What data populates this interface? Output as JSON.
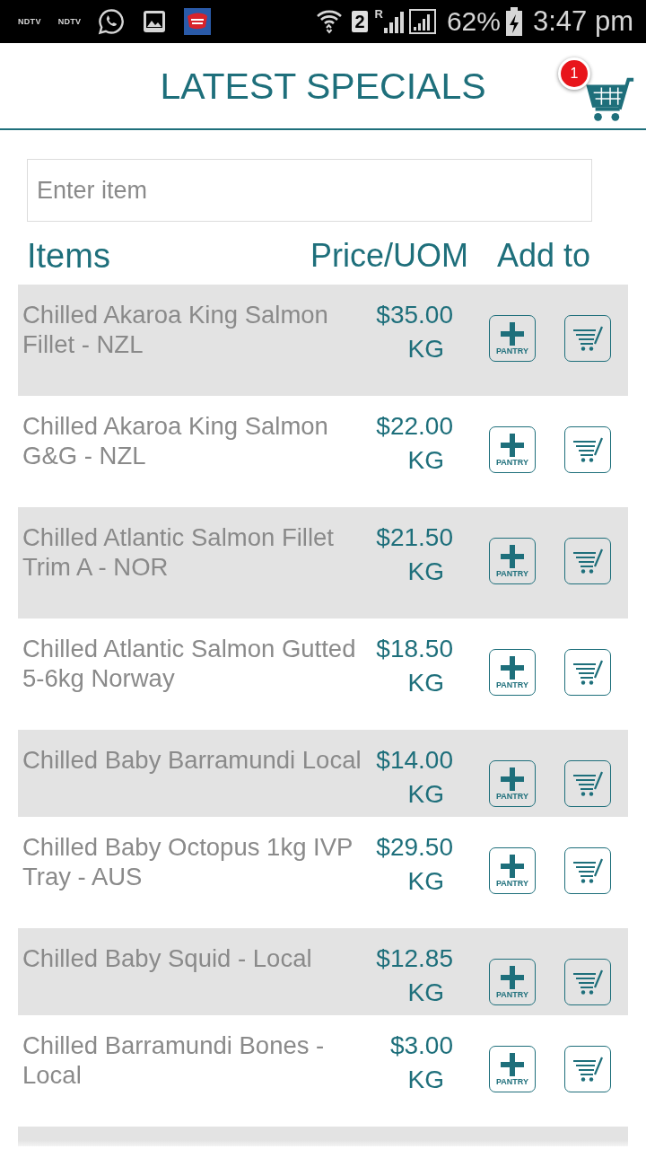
{
  "status_bar": {
    "notification_labels": [
      "NDTV",
      "NDTV"
    ],
    "sim": "2",
    "roaming": "R",
    "battery": "62%",
    "time": "3:47 pm"
  },
  "header": {
    "title": "LATEST SPECIALS",
    "cart_count": "1"
  },
  "search": {
    "placeholder": "Enter item"
  },
  "columns": [
    "Items",
    "Price/UOM",
    "Add to"
  ],
  "rows": [
    {
      "name": "Chilled Akaroa King Salmon Fillet - NZL",
      "price": "$35.00",
      "uom": "KG",
      "pantry_label": "PANTRY"
    },
    {
      "name": "Chilled Akaroa King Salmon G&G - NZL",
      "price": "$22.00",
      "uom": "KG",
      "pantry_label": "PANTRY"
    },
    {
      "name": "Chilled Atlantic Salmon Fillet Trim A - NOR",
      "price": "$21.50",
      "uom": "KG",
      "pantry_label": "PANTRY"
    },
    {
      "name": "Chilled Atlantic Salmon Gutted 5-6kg Norway",
      "price": "$18.50",
      "uom": "KG",
      "pantry_label": "PANTRY"
    },
    {
      "name": "Chilled Baby Barramundi Local",
      "price": "$14.00",
      "uom": "KG",
      "pantry_label": "PANTRY"
    },
    {
      "name": "Chilled Baby Octopus 1kg IVP Tray - AUS",
      "price": "$29.50",
      "uom": "KG",
      "pantry_label": "PANTRY"
    },
    {
      "name": "Chilled Baby Squid - Local",
      "price": "$12.85",
      "uom": "KG",
      "pantry_label": "PANTRY"
    },
    {
      "name": "Chilled Barramundi Bones - Local",
      "price": "$3.00",
      "uom": "KG",
      "pantry_label": "PANTRY"
    }
  ]
}
